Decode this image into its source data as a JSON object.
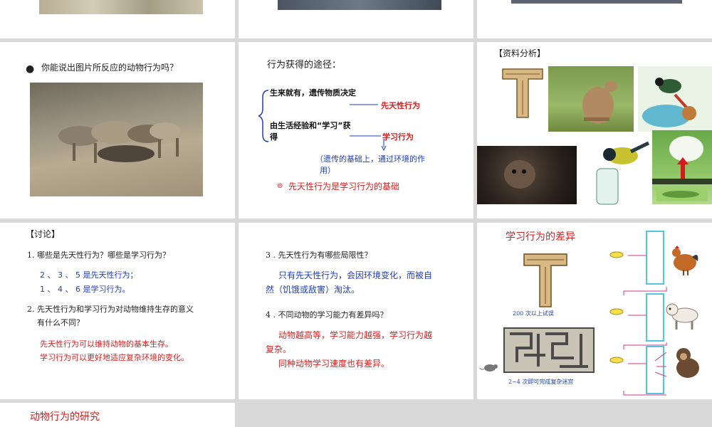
{
  "slide_p2": {
    "question": "你能说出图片所反应的动物行为吗？"
  },
  "slide_p3": {
    "heading": "行为获得的途径：",
    "branch1": "生来就有，遗传物质决定",
    "label1": "先天性行为",
    "branch2_line1": "由生活经验和“学习”获",
    "branch2_line2": "得",
    "label2": "学习行为",
    "note_line1": "（遗传的基础上，通过环境的作",
    "note_line2": "用）",
    "conclusion": "先天性行为是学习行为的基础"
  },
  "slide_p4": {
    "heading": "【资料分析】"
  },
  "slide_p5": {
    "heading": "【讨论】",
    "q1": "1. 哪些是先天性行为？哪些是学习行为？",
    "a1_line1": "2 、 3 、 5  是先天性行为；",
    "a1_line2": "1 、 4 、 6 是学习行为。",
    "q2_line1": "2. 先天性行为和学习行为对动物维持生存的意义",
    "q2_line2": "有什么不同？",
    "a2_line1": "先天性行为可以维持动物的基本生存。",
    "a2_line2": "学习行为可以更好地适应复杂环境的变化。"
  },
  "slide_p6": {
    "q3": "3 .   先天性行为有哪些局限性？",
    "a3_line1": "只有先天性行为，会因环境变化，而被自",
    "a3_line2": "然（饥饿或敌害）淘汰。",
    "q4": "4 . 不同动物的学习能力有差异吗？",
    "a4_line1": "动物越高等，学习能力越强，学习行为越",
    "a4_line2": "复杂。",
    "a4_line3": "同种动物学习速度也有差异。"
  },
  "slide_p7": {
    "title": "学习行为的差异",
    "caption1": "200 次以上试误",
    "caption2": "2~4 次即可完成复杂迷宫"
  },
  "slide_p8": {
    "title": "动物行为的研究"
  },
  "colors": {
    "blue_text": "#1f3fb8",
    "red_text": "#d81e1e",
    "slide_bg": "#ffffff",
    "gap_bg": "#d9d9d9"
  }
}
